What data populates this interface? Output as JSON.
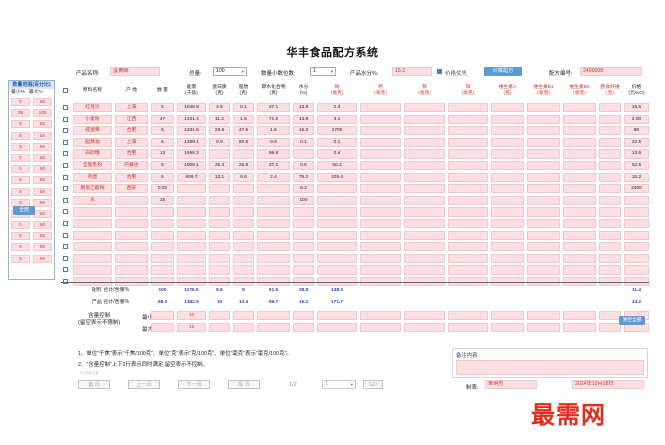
{
  "app_title": "华丰食品配方系统",
  "product": {
    "name_label": "产品名称:",
    "name_value": "蛋黄酥"
  },
  "total": {
    "label": "总量:",
    "value": "100"
  },
  "decimals": {
    "label": "数量小数位数:",
    "value": "1"
  },
  "water": {
    "label": "产品水分%:",
    "value": "15.2"
  },
  "price_first": {
    "label": "价格优先",
    "checked": true
  },
  "calc_button": "计算配方",
  "formula_no": {
    "label": "配方编号:",
    "value": "2409008"
  },
  "side_panel": {
    "title": "数量范围(百分比)",
    "col_min": "最小%",
    "col_max": "最大%",
    "rows": [
      [
        "5",
        "50"
      ],
      [
        "35",
        "100"
      ],
      [
        "5",
        "50"
      ],
      [
        "5",
        "50"
      ],
      [
        "5",
        "50"
      ],
      [
        "5",
        "50"
      ],
      [
        "5",
        "50"
      ],
      [
        "5",
        "50"
      ],
      [
        "5",
        "50"
      ],
      [
        "5",
        "50"
      ],
      [
        "5",
        "50"
      ],
      [
        "5",
        "50"
      ],
      [
        "5",
        "50"
      ],
      [
        "5",
        "50"
      ],
      [
        "5",
        "50"
      ]
    ],
    "button": "全部"
  },
  "table": {
    "headers": [
      "原料名称",
      "产 地",
      "数 量",
      "能量\n(千焦)",
      "蛋白质\n(克)",
      "脂肪\n(克)",
      "碳水化合物\n(克)",
      "水分\n(%)",
      "钠\n(毫克)",
      "钙\n(毫克)",
      "铁\n(毫克)",
      "锌\n(毫克)",
      "维生素A\n(克)",
      "维生素B1\n(毫克)",
      "维生素B2\n(毫克)",
      "膳食纤维\n(克)",
      "价格\n(元/KG)"
    ],
    "rows": [
      {
        "name": "红豆沙",
        "origin": "上海",
        "qty": "5",
        "energy": "1048.9",
        "protein": "4.5",
        "fat": "0.1",
        "carb": "37.1",
        "water": "13.8",
        "sodium": "2.3",
        "price": "15.5"
      },
      {
        "name": "小麦粉",
        "origin": "江西",
        "qty": "47",
        "energy": "1431.4",
        "protein": "11.2",
        "fat": "1.5",
        "carb": "71.5",
        "water": "13.9",
        "sodium": "3.1",
        "price": "2.00"
      },
      {
        "name": "咸蛋黄",
        "origin": "合肥",
        "qty": "5",
        "energy": "1331.5",
        "protein": "23.6",
        "fat": "47.6",
        "carb": "1.5",
        "water": "15.2",
        "sodium": "2700",
        "price": "80"
      },
      {
        "name": "起酥油",
        "origin": "上海",
        "qty": "5",
        "energy": "1399.1",
        "protein": "0.9",
        "fat": "80.5",
        "carb": "0.9",
        "water": "0.1",
        "sodium": "0.1",
        "price": "22.5"
      },
      {
        "name": "白砂糖",
        "origin": "合肥",
        "qty": "13",
        "energy": "1698.3",
        "protein": "",
        "fat": "",
        "carb": "99.9",
        "water": "",
        "sodium": "0.4",
        "price": "13.6"
      },
      {
        "name": "全脂乳粉",
        "origin": "内蒙古",
        "qty": "5",
        "energy": "1909.1",
        "protein": "25.4",
        "fat": "29.8",
        "carb": "37.1",
        "water": "0.6",
        "sodium": "50.2",
        "price": "52.5"
      },
      {
        "name": "鸡蛋",
        "origin": "合肥",
        "qty": "5",
        "energy": "609.7",
        "protein": "13.1",
        "fat": "8.6",
        "carb": "2.4",
        "water": "75.2",
        "sodium": "105.4",
        "price": "10.2"
      },
      {
        "name": "脱氢乙酸钠",
        "origin": "西安",
        "qty": "0.02",
        "energy": "",
        "protein": "",
        "fat": "",
        "carb": "",
        "water": "8.3",
        "sodium": "",
        "price": "2400"
      },
      {
        "name": "水",
        "origin": "",
        "qty": "15",
        "energy": "",
        "protein": "",
        "fat": "",
        "carb": "",
        "water": "100",
        "sodium": "",
        "price": ""
      }
    ],
    "blank_rows": 7
  },
  "summary": [
    {
      "label": "配料 合计/含量%",
      "qty": "100",
      "energy": "1176.5",
      "protein": "8.6",
      "fat": "9",
      "carb": "51.5",
      "water": "28.8",
      "sodium": "148.2",
      "price": "11.4"
    },
    {
      "label": "产品 合计/含量%",
      "qty": "98.3",
      "energy": "1362.9",
      "protein": "10",
      "fat": "10.4",
      "carb": "59.7",
      "water": "15.2",
      "sodium": "171.7",
      "price": "13.2"
    }
  ],
  "content_control": {
    "label": "含量控制\n(留空表示不限制)",
    "min_label": "最小含量",
    "max_label": "最大含量",
    "min_value": "10",
    "max_value": "15",
    "right_button": "清空全部"
  },
  "notes": {
    "line1": "1、单位\"千焦\"表示\"千焦/100克\"、单位\"克\"表示\"克/100克\"、单位\"毫克\"表示\"毫克/100克\"。",
    "line2": "2、\"含量控制\"上下2行表示同时满足,留空表示不控制。",
    "formula_hint": "1 + 13 = 0"
  },
  "pager": {
    "first": "首 页",
    "prev": "上一页",
    "next": "下一页",
    "last": "尾 页",
    "page": "1/2",
    "page_select": "1",
    "go": "GO"
  },
  "memo": {
    "label": "备注内容"
  },
  "maker": {
    "label": "制表:",
    "value": "朱明杰"
  },
  "date": {
    "value": "2024年10月08日"
  },
  "watermark": "最需网"
}
